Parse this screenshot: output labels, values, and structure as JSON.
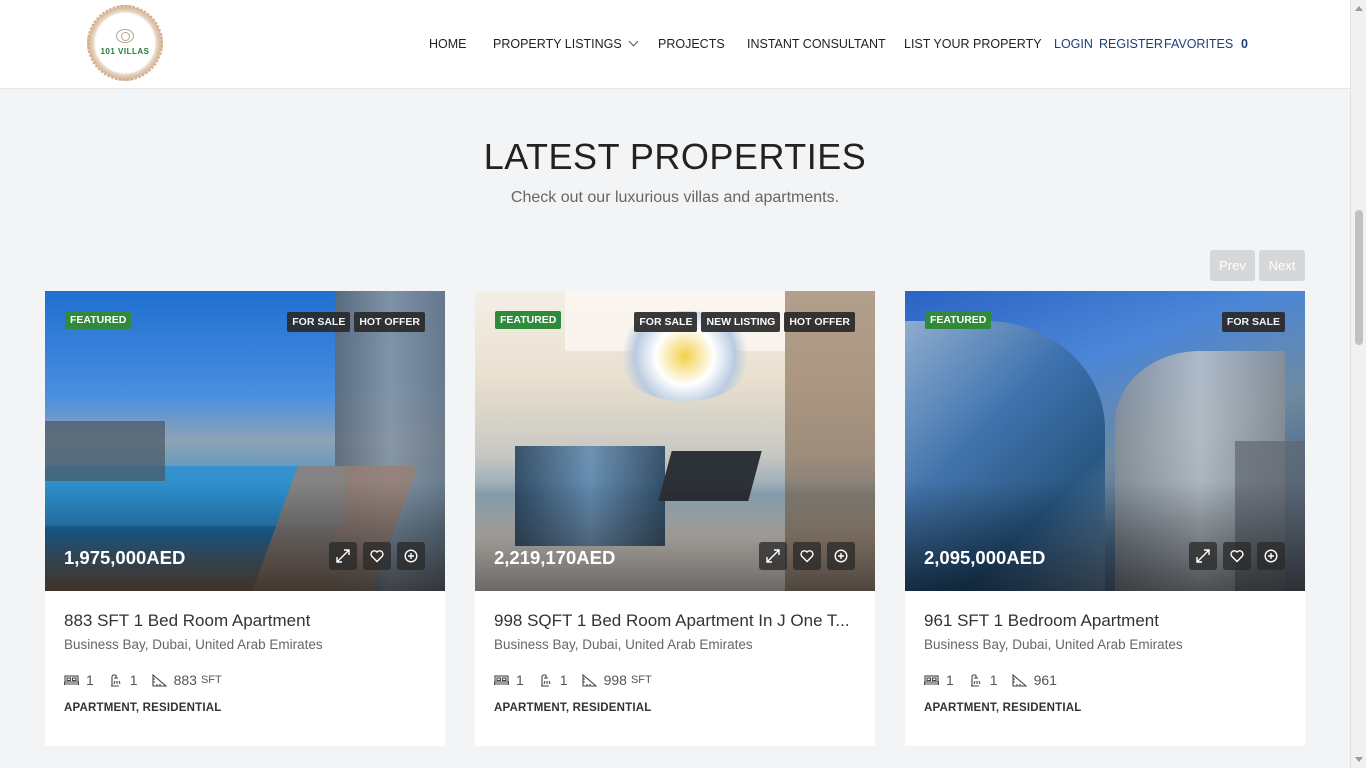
{
  "header": {
    "logo_text": "101 VILLAS",
    "nav": [
      {
        "label": "HOME",
        "name": "nav-home"
      },
      {
        "label": "PROPERTY LISTINGS",
        "name": "nav-property-listings",
        "dropdown": true
      },
      {
        "label": "PROJECTS",
        "name": "nav-projects"
      },
      {
        "label": "INSTANT CONSULTANT",
        "name": "nav-instant-consultant"
      },
      {
        "label": "LIST YOUR PROPERTY",
        "name": "nav-list-your-property"
      }
    ],
    "login": "LOGIN",
    "register": "REGISTER",
    "favorites": "FAVORITES",
    "favorites_count": "0"
  },
  "section": {
    "title": "LATEST PROPERTIES",
    "subtitle": "Check out our luxurious villas and apartments."
  },
  "pager": {
    "prev": "Prev",
    "next": "Next"
  },
  "colors": {
    "featured": "#2f8a3c",
    "nav_blue": "#1c3f78",
    "badge": "#2a2a2a"
  },
  "listings": [
    {
      "featured": "FEATURED",
      "badges": [
        "FOR SALE",
        "HOT OFFER"
      ],
      "price": "1,975,000AED",
      "title": "883 SFT 1 Bed Room Apartment",
      "address": "Business Bay, Dubai, United Arab Emirates",
      "beds": "1",
      "baths": "1",
      "area": "883",
      "area_unit": "SFT",
      "categories": "APARTMENT, RESIDENTIAL"
    },
    {
      "featured": "FEATURED",
      "badges": [
        "FOR SALE",
        "NEW LISTING",
        "HOT OFFER"
      ],
      "price": "2,219,170AED",
      "title": "998 SQFT 1 Bed Room Apartment In J One T...",
      "address": "Business Bay, Dubai, United Arab Emirates",
      "beds": "1",
      "baths": "1",
      "area": "998",
      "area_unit": "SFT",
      "categories": "APARTMENT, RESIDENTIAL"
    },
    {
      "featured": "FEATURED",
      "badges": [
        "FOR SALE"
      ],
      "price": "2,095,000AED",
      "title": "961 SFT 1 Bedroom Apartment",
      "address": "Business Bay, Dubai, United Arab Emirates",
      "beds": "1",
      "baths": "1",
      "area": "961",
      "area_unit": "",
      "categories": "APARTMENT, RESIDENTIAL"
    }
  ],
  "icons": {
    "bed": "bed-icon",
    "bath": "bath-icon",
    "area": "area-icon",
    "expand": "expand-icon",
    "favorite": "heart-icon",
    "compare": "plus-circle-icon"
  }
}
